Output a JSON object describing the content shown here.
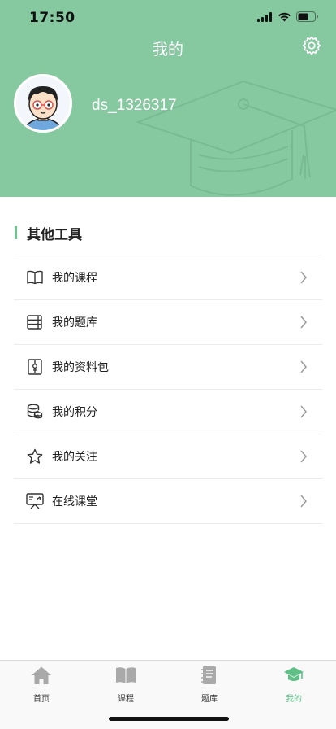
{
  "status_bar": {
    "time": "17:50"
  },
  "header": {
    "title": "我的",
    "username": "ds_1326317"
  },
  "section": {
    "title": "其他工具"
  },
  "menu": {
    "items": [
      {
        "label": "我的课程",
        "icon": "book-icon"
      },
      {
        "label": "我的题库",
        "icon": "question-bank-icon"
      },
      {
        "label": "我的资料包",
        "icon": "package-icon"
      },
      {
        "label": "我的积分",
        "icon": "coins-icon"
      },
      {
        "label": "我的关注",
        "icon": "star-icon"
      },
      {
        "label": "在线课堂",
        "icon": "online-class-icon"
      }
    ]
  },
  "tabbar": {
    "items": [
      {
        "label": "首页",
        "icon": "home-icon"
      },
      {
        "label": "课程",
        "icon": "book-icon"
      },
      {
        "label": "题库",
        "icon": "notebook-icon"
      },
      {
        "label": "我的",
        "icon": "graduation-cap-icon",
        "active": true
      }
    ]
  },
  "colors": {
    "header_bg": "#86c9a0",
    "accent": "#5fbf86"
  }
}
